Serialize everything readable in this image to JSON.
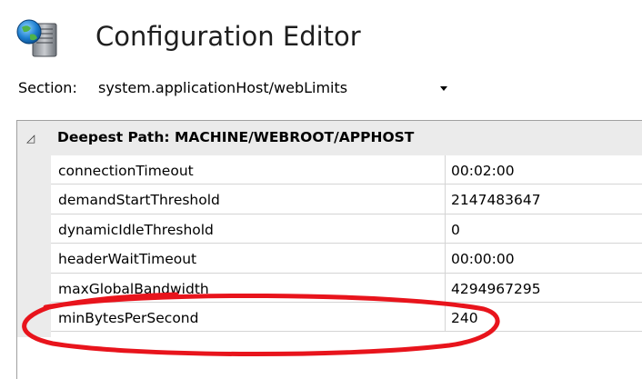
{
  "header": {
    "title": "Configuration Editor",
    "icon": "server-config-icon"
  },
  "section": {
    "label": "Section:",
    "value": "system.applicationHost/webLimits"
  },
  "grid": {
    "group_label": "Deepest Path: MACHINE/WEBROOT/APPHOST",
    "collapse_glyph": "◿",
    "rows": [
      {
        "name": "connectionTimeout",
        "value": "00:02:00"
      },
      {
        "name": "demandStartThreshold",
        "value": "2147483647"
      },
      {
        "name": "dynamicIdleThreshold",
        "value": "0"
      },
      {
        "name": "headerWaitTimeout",
        "value": "00:00:00"
      },
      {
        "name": "maxGlobalBandwidth",
        "value": "4294967295"
      },
      {
        "name": "minBytesPerSecond",
        "value": "240"
      }
    ]
  },
  "annotation": {
    "color": "#e8141c"
  }
}
